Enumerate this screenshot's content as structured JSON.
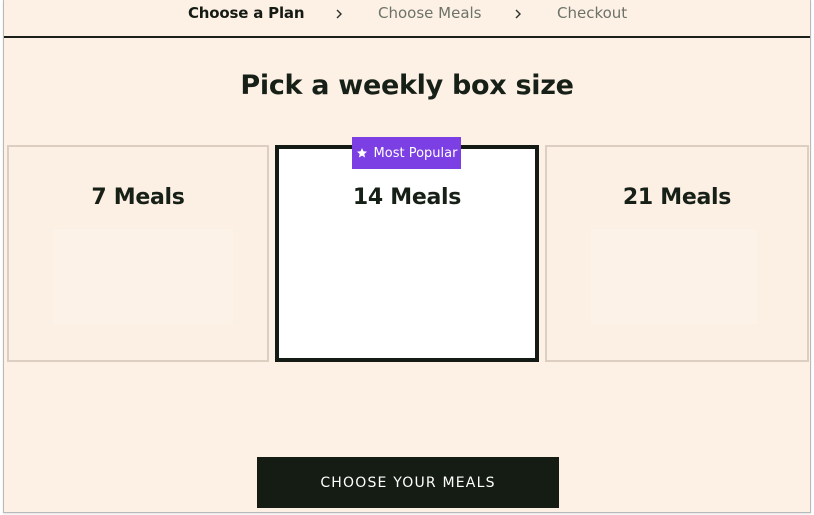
{
  "steps": {
    "items": [
      {
        "label": "Choose a Plan",
        "state": "active"
      },
      {
        "label": "Choose Meals",
        "state": "upcoming"
      },
      {
        "label": "Checkout",
        "state": "upcoming"
      }
    ]
  },
  "main": {
    "title": "Pick a weekly box size"
  },
  "plans": [
    {
      "label": "7 Meals",
      "selected": false
    },
    {
      "label": "14 Meals",
      "selected": true,
      "badge": "Most Popular",
      "badge_icon": "star-icon"
    },
    {
      "label": "21 Meals",
      "selected": false
    }
  ],
  "cta": {
    "label": "CHOOSE YOUR MEALS"
  },
  "colors": {
    "background": "#fdf1e6",
    "dark": "#141c14",
    "badge": "#7b3fe4"
  }
}
